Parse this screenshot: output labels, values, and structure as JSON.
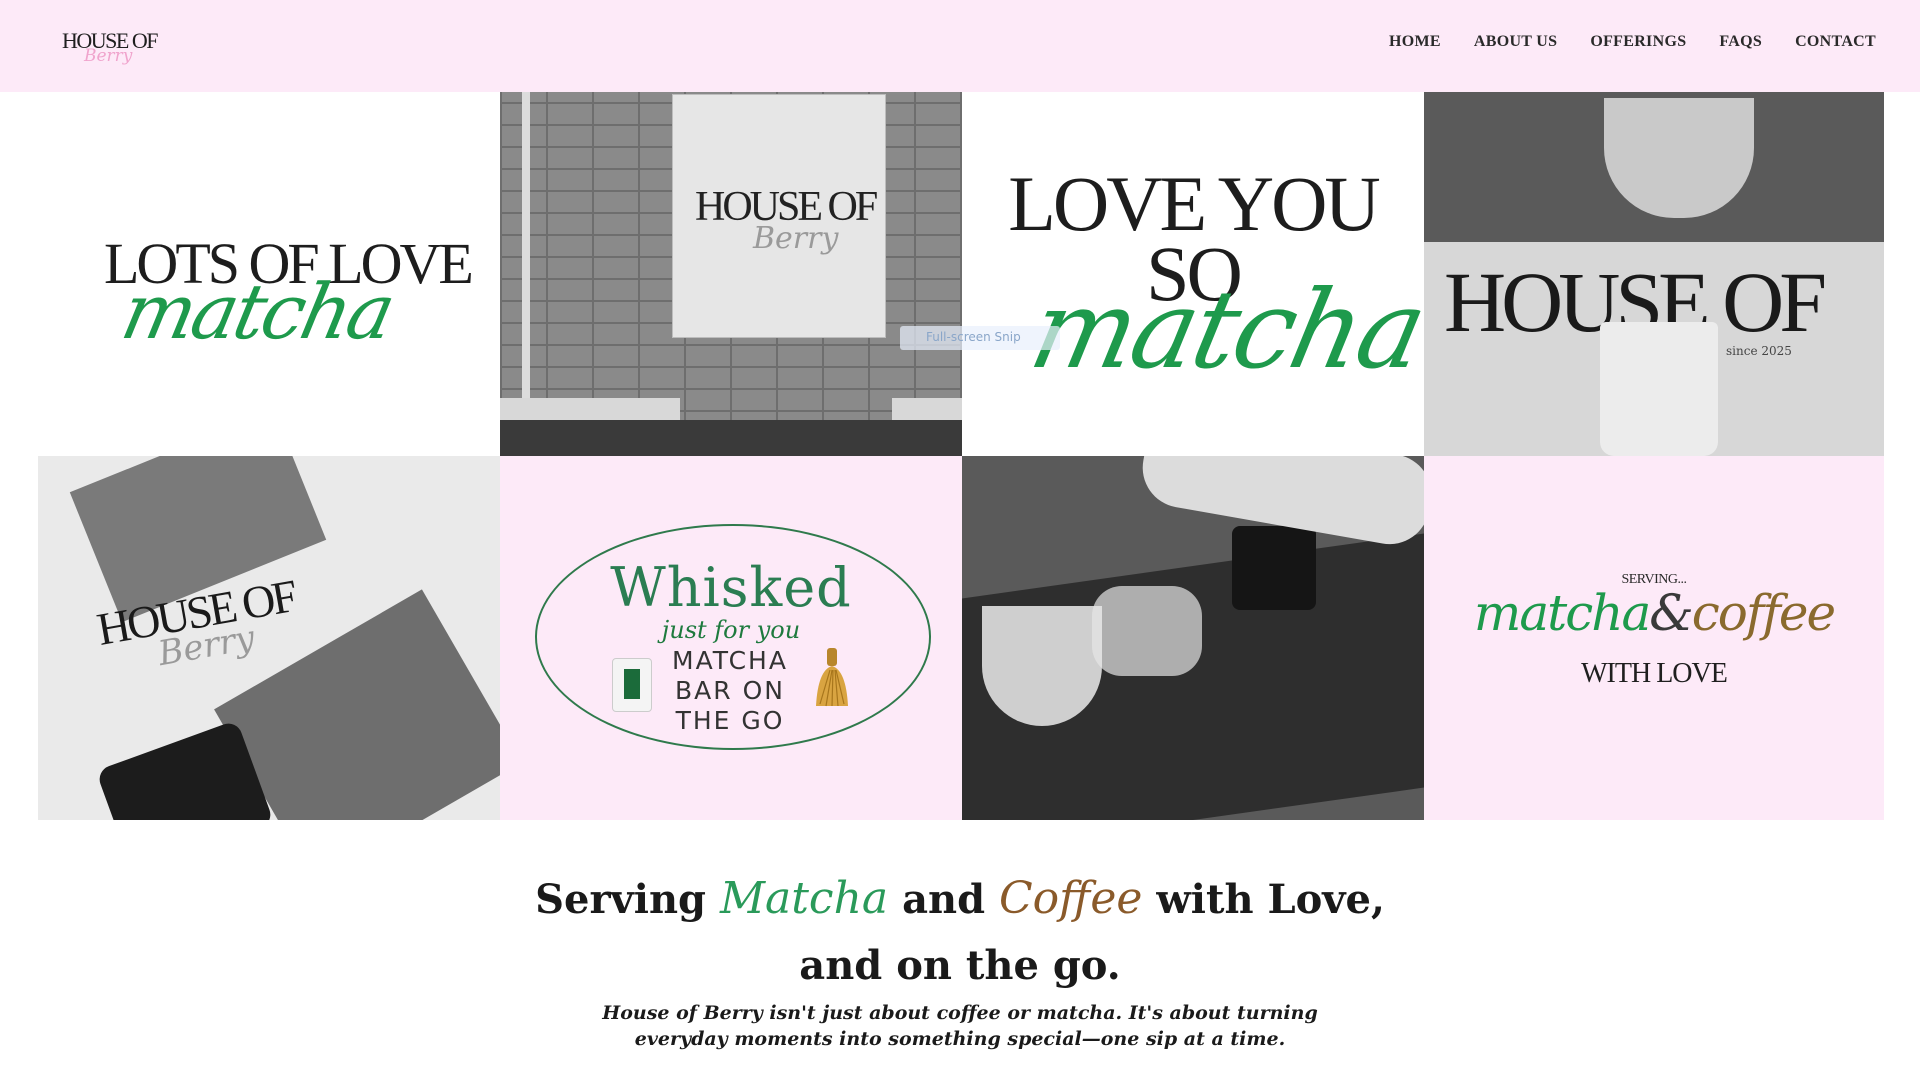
{
  "header": {
    "logo": {
      "top": "HOUSE OF",
      "script": "Berry"
    },
    "nav": [
      "HOME",
      "ABOUT US",
      "OFFERINGS",
      "FAQS",
      "CONTACT"
    ]
  },
  "tiles": {
    "t1": {
      "serif": "LOTS OF LOVE",
      "script": "matcha"
    },
    "t2": {
      "banner_top": "HOUSE OF",
      "banner_script": "Berry"
    },
    "t3": {
      "line1": "LOVE YOU",
      "line2": "SO",
      "script": "matcha"
    },
    "t4": {
      "sign": "HOUSE OF",
      "since": "since 2025"
    },
    "t5": {
      "sign": "HOUSE OF",
      "script": "Berry"
    },
    "t6": {
      "title": "Whisked",
      "subtitle": "just for you",
      "body_lines": [
        "MATCHA",
        "BAR ON",
        "THE GO"
      ]
    },
    "t8": {
      "serving": "SERVING...",
      "matcha": "matcha",
      "amp": "&",
      "coffee": "coffee",
      "with_love": "WITH LOVE"
    }
  },
  "snip": "Full-screen Snip",
  "hero": {
    "part1": "Serving",
    "matcha": "Matcha",
    "part2": "and",
    "coffee": "Coffee",
    "part3": "with Love,",
    "line2": "and on the go."
  },
  "description": {
    "line1": "House of Berry isn't just about coffee or matcha. It's about turning",
    "line2": "everyday moments into something special—one sip at a time."
  },
  "colors": {
    "header_bg": "#fdeaf8",
    "matcha_green": "#1e9a4c",
    "coffee_brown": "#8a5a2a",
    "logo_pink": "#f0a4cd"
  }
}
